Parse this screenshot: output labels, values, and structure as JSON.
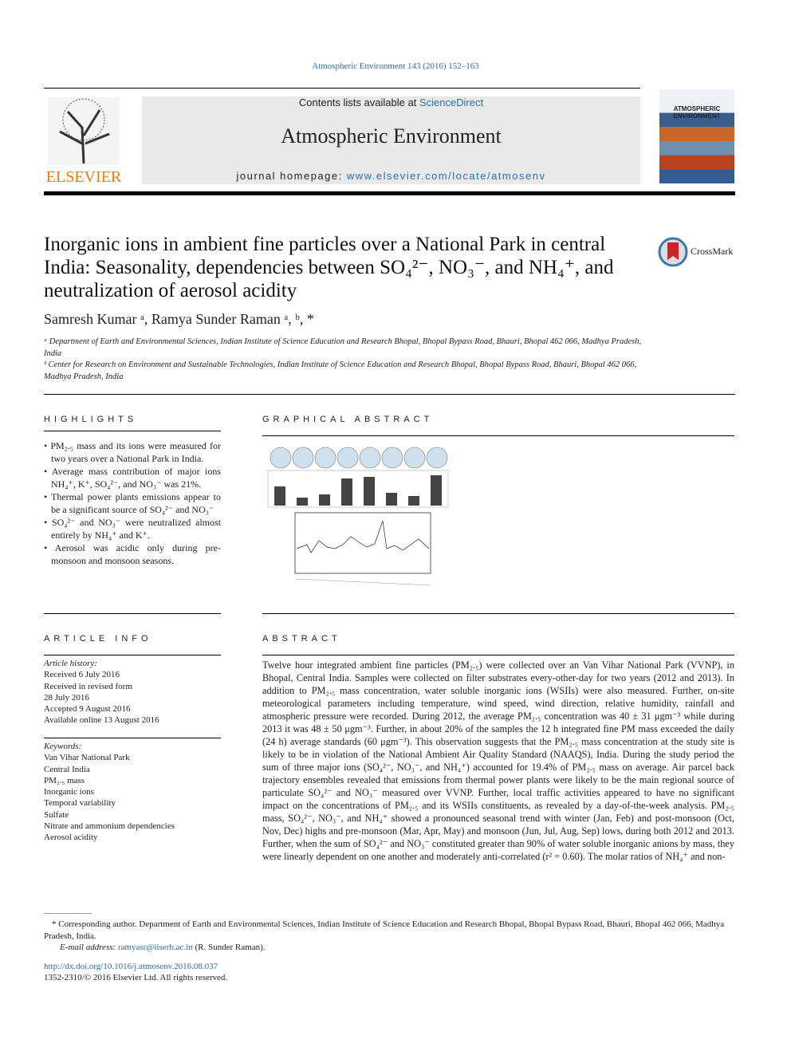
{
  "header": {
    "journal_ref": "Atmospheric Environment 143 (2016) 152–163",
    "contents_prefix": "Contents lists available at ",
    "contents_link": "ScienceDirect",
    "journal_title": "Atmospheric Environment",
    "homepage_prefix": "journal homepage: ",
    "homepage_link": "www.elsevier.com/locate/atmosenv",
    "publisher_logo": "ELSEVIER",
    "cover_title": "ATMOSPHERIC ENVIRONMENT",
    "crossmark": "CrossMark"
  },
  "article": {
    "title": "Inorganic ions in ambient fine particles over a National Park in central India: Seasonality, dependencies between SO₄²⁻, NO₃⁻, and NH₄⁺, and neutralization of aerosol acidity",
    "authors": "Samresh Kumar ᵃ, Ramya Sunder Raman ᵃ, ᵇ, *",
    "affiliations": [
      "ᵃ Department of Earth and Environmental Sciences, Indian Institute of Science Education and Research Bhopal, Bhopal Bypass Road, Bhauri, Bhopal 462 066, Madhya Pradesh, India",
      "ᵇ Center for Research on Environment and Sustainable Technologies, Indian Institute of Science Education and Research Bhopal, Bhopal Bypass Road, Bhauri, Bhopal 462 066, Madhya Pradesh, India"
    ]
  },
  "highlights": {
    "heading": "HIGHLIGHTS",
    "items": [
      "• PM₂.₅ mass and its ions were measured for two years over a National Park in India.",
      "• Average mass contribution of major ions NH₄⁺, K⁺, SO₄²⁻, and NO₃⁻ was 21%.",
      "• Thermal power plants emissions appear to be a significant source of SO₄²⁻ and NO₃⁻",
      "• SO₄²⁻ and NO₃⁻ were neutralized almost entirely by NH₄⁺ and K⁺.",
      "• Aerosol was acidic only during pre-monsoon and monsoon seasons."
    ]
  },
  "graphical_abstract": {
    "heading": "GRAPHICAL ABSTRACT"
  },
  "article_info": {
    "heading": "ARTICLE INFO",
    "history_label": "Article history:",
    "history": [
      "Received 6 July 2016",
      "Received in revised form",
      "28 July 2016",
      "Accepted 9 August 2016",
      "Available online 13 August 2016"
    ],
    "keywords_label": "Keywords:",
    "keywords": [
      "Van Vihar National Park",
      "Central India",
      "PM₂.₅ mass",
      "Inorganic ions",
      "Temporal variability",
      "Sulfate",
      "Nitrate and ammonium dependencies",
      "Aerosol acidity"
    ]
  },
  "abstract": {
    "heading": "ABSTRACT",
    "text": "Twelve hour integrated ambient fine particles (PM₂.₅) were collected over an Van Vihar National Park (VVNP), in Bhopal, Central India. Samples were collected on filter substrates every-other-day for two years (2012 and 2013). In addition to PM₂.₅ mass concentration, water soluble inorganic ions (WSIIs) were also measured. Further, on-site meteorological parameters including temperature, wind speed, wind direction, relative humidity, rainfall and atmospheric pressure were recorded. During 2012, the average PM₂.₅ concentration was 40 ± 31 μgm⁻³ while during 2013 it was 48 ± 50 μgm⁻³. Further, in about 20% of the samples the 12 h integrated fine PM mass exceeded the daily (24 h) average standards (60 μgm⁻³). This observation suggests that the PM₂.₅ mass concentration at the study site is likely to be in violation of the National Ambient Air Quality Standard (NAAQS), India. During the study period the sum of three major ions (SO₄²⁻, NO₃⁻, and NH₄⁺) accounted for 19.4% of PM₂.₅ mass on average. Air parcel back trajectory ensembles revealed that emissions from thermal power plants were likely to be the main regional source of particulate SO₄²⁻ and NO₃⁻ measured over VVNP. Further, local traffic activities appeared to have no significant impact on the concentrations of PM₂.₅ and its WSIIs constituents, as revealed by a day-of-the-week analysis. PM₂.₅ mass, SO₄²⁻, NO₃⁻, and NH₄⁺ showed a pronounced seasonal trend with winter (Jan, Feb) and post-monsoon (Oct, Nov, Dec) highs and pre-monsoon (Mar, Apr, May) and monsoon (Jun, Jul, Aug, Sep) lows, during both 2012 and 2013. Further, when the sum of SO₄²⁻ and NO₃⁻ constituted greater than 90% of water soluble inorganic anions by mass, they were linearly dependent on one another and moderately anti-correlated (r² = 0.60). The molar ratios of NH₄⁺ and non-"
  },
  "footer": {
    "corresponding": "* Corresponding author. Department of Earth and Environmental Sciences, Indian Institute of Science Education and Research Bhopal, Bhopal Bypass Road, Bhauri, Bhopal 462 066, Madhya Pradesh, India.",
    "email_label": "E-mail address: ",
    "email": "ramyasr@iiserb.ac.in",
    "email_suffix": " (R. Sunder Raman).",
    "doi": "http://dx.doi.org/10.1016/j.atmosenv.2016.08.037",
    "copyright": "1352-2310/© 2016 Elsevier Ltd. All rights reserved."
  }
}
